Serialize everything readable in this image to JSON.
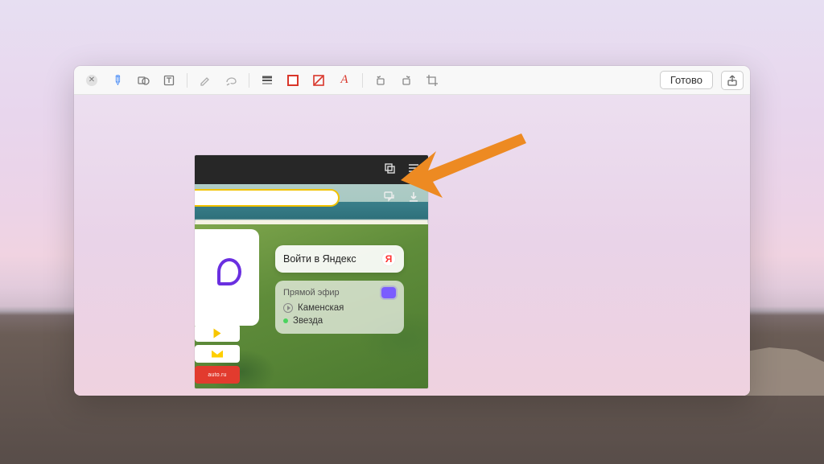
{
  "toolbar": {
    "done_label": "Готово"
  },
  "icons": {
    "close": "close",
    "pen": "pen",
    "shape": "shape",
    "text": "text",
    "highlight": "highlight",
    "lasso": "lasso",
    "line_style": "line-style",
    "stroke_color": "stroke-color",
    "fill_color": "fill-color",
    "font": "font",
    "rotate_left": "rotate-left",
    "rotate_right": "rotate-right",
    "crop": "crop",
    "share": "share"
  },
  "shot": {
    "login_card": {
      "label": "Войти в Яндекс",
      "logo": "Я"
    },
    "live": {
      "title": "Прямой эфир",
      "item1": "Каменская",
      "item2": "Звезда"
    },
    "tiles": {
      "auto": "auto.ru"
    }
  },
  "annotation": {
    "arrow_color": "#ed8a22"
  }
}
